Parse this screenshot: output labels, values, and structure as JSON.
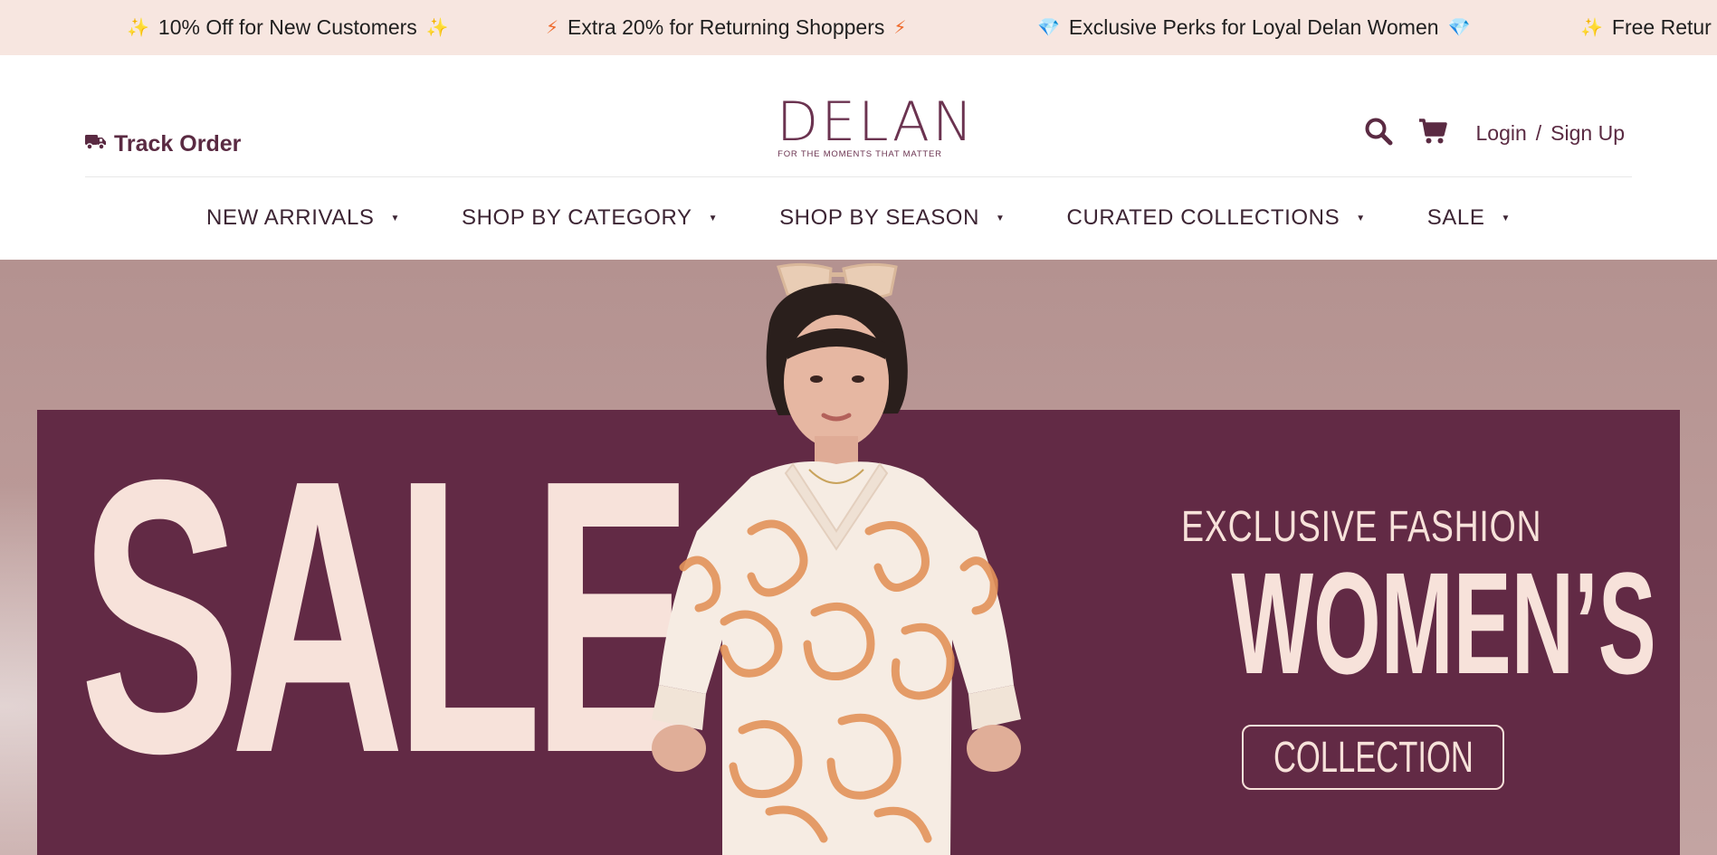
{
  "promo_bar": {
    "items": [
      {
        "text": "10% Off for New Customers",
        "icon": "sparkle-icon",
        "glyph": "✨"
      },
      {
        "text": "Extra 20% for Returning Shoppers",
        "icon": "bolt-icon",
        "glyph": "⚡"
      },
      {
        "text": "Exclusive Perks for Loyal Delan Women",
        "icon": "gem-icon",
        "glyph": "💎"
      },
      {
        "text": "Free Retur",
        "icon": "sparkle-icon",
        "glyph": "✨"
      }
    ]
  },
  "header": {
    "track_order": {
      "label": "Track Order",
      "icon": "truck-icon"
    },
    "logo": {
      "word": "DELAN",
      "tagline": "FOR THE MOMENTS THAT MATTER"
    },
    "search_icon": "search-icon",
    "cart_icon": "cart-icon",
    "auth": {
      "login": "Login",
      "separator": "/",
      "signup": "Sign Up"
    }
  },
  "nav": {
    "items": [
      {
        "label": "NEW ARRIVALS"
      },
      {
        "label": "SHOP BY CATEGORY"
      },
      {
        "label": "SHOP BY SEASON"
      },
      {
        "label": "CURATED COLLECTIONS"
      },
      {
        "label": "SALE"
      }
    ],
    "caret_glyph": "▼"
  },
  "hero": {
    "big_word": "SALE",
    "subtitle": "EXCLUSIVE FASHION",
    "title": "WOMEN’S",
    "cta": "COLLECTION"
  },
  "colors": {
    "brand": "#622a45",
    "promo_bg": "#f7e6e0",
    "hero_text": "#f7e2da",
    "hero_bg": "#b49290"
  }
}
